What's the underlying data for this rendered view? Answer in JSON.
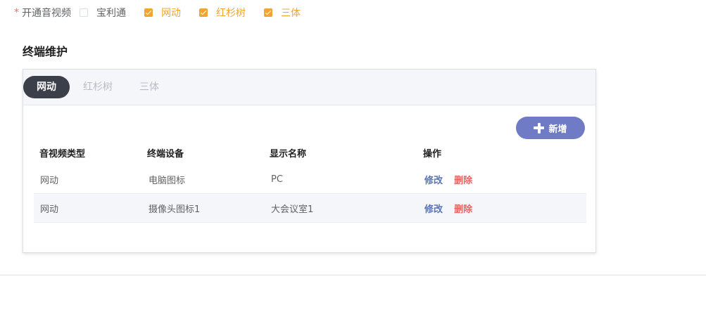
{
  "av_row": {
    "required_mark": "*",
    "label": "开通音视频",
    "options": [
      {
        "label": "宝利通",
        "checked": false
      },
      {
        "label": "网动",
        "checked": true
      },
      {
        "label": "红杉树",
        "checked": true
      },
      {
        "label": "三体",
        "checked": true
      }
    ]
  },
  "section": {
    "title": "终端维护"
  },
  "tabs": [
    {
      "label": "网动",
      "active": true
    },
    {
      "label": "红杉树",
      "active": false
    },
    {
      "label": "三体",
      "active": false
    }
  ],
  "toolbar": {
    "add_label": "新增"
  },
  "table": {
    "columns": [
      "音视频类型",
      "终端设备",
      "显示名称",
      "操作"
    ],
    "rows": [
      {
        "type": "网动",
        "device": "电脑图标",
        "name": "PC",
        "edit": "修改",
        "delete": "删除"
      },
      {
        "type": "网动",
        "device": "摄像头图标1",
        "name": "大会议室1",
        "edit": "修改",
        "delete": "删除"
      }
    ]
  },
  "colors": {
    "accent_orange": "#f0a533",
    "required_red": "#f56c6c",
    "tab_active_bg": "#3b3f4a",
    "add_button_bg": "#6f7bc4",
    "edit_link": "#5b74b8",
    "delete_link": "#e86464"
  }
}
